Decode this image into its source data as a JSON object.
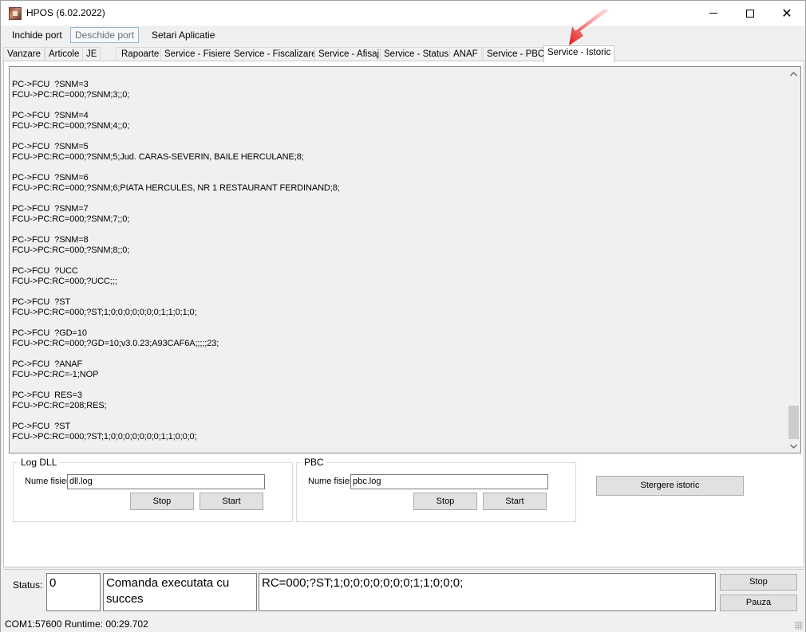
{
  "window": {
    "title": "HPOS (6.02.2022)"
  },
  "menu": {
    "items": [
      "Inchide port",
      "Deschide port",
      "Setari Aplicatie"
    ]
  },
  "tabs": [
    "Vanzare",
    "Articole",
    "JE",
    "Rapoarte",
    "Service - Fisiere",
    "Service - Fiscalizare",
    "Service - Afisaj",
    "Service - Status",
    "ANAF",
    "Service - PBC",
    "Service - Istoric"
  ],
  "active_tab": "Service - Istoric",
  "log": [
    [
      "PC->FCU  ?SNM=3",
      "FCU->PC:RC=000;?SNM;3;;0;"
    ],
    [
      "PC->FCU  ?SNM=4",
      "FCU->PC:RC=000;?SNM;4;;0;"
    ],
    [
      "PC->FCU  ?SNM=5",
      "FCU->PC:RC=000;?SNM;5;Jud. CARAS-SEVERIN, BAILE HERCULANE;8;"
    ],
    [
      "PC->FCU  ?SNM=6",
      "FCU->PC:RC=000;?SNM;6;PIATA HERCULES, NR 1 RESTAURANT FERDINAND;8;"
    ],
    [
      "PC->FCU  ?SNM=7",
      "FCU->PC:RC=000;?SNM;7;;0;"
    ],
    [
      "PC->FCU  ?SNM=8",
      "FCU->PC:RC=000;?SNM;8;;0;"
    ],
    [
      "PC->FCU  ?UCC",
      "FCU->PC:RC=000;?UCC;;;"
    ],
    [
      "PC->FCU  ?ST",
      "FCU->PC:RC=000;?ST;1;0;0;0;0;0;0;0;1;1;0;1;0;"
    ],
    [
      "PC->FCU  ?GD=10",
      "FCU->PC:RC=000;?GD=10;v3.0.23;A93CAF6A;;;;;23;"
    ],
    [
      "PC->FCU  ?ANAF",
      "FCU->PC:RC=-1;NOP"
    ],
    [
      "PC->FCU  RES=3",
      "FCU->PC:RC=208;RES;"
    ],
    [
      "PC->FCU  ?ST",
      "FCU->PC:RC=000;?ST;1;0;0;0;0;0;0;0;1;1;0;0;0;"
    ]
  ],
  "log_dll": {
    "title": "Log DLL",
    "file_label": "Nume fisier",
    "file_value": "dll.log",
    "stop": "Stop",
    "start": "Start"
  },
  "pbc": {
    "title": "PBC",
    "file_label": "Nume fisier",
    "file_value": "pbc.log",
    "stop": "Stop",
    "start": "Start"
  },
  "clear_history": "Stergere istoric",
  "status": {
    "label": "Status:",
    "code": "0",
    "message": "Comanda executata cu succes",
    "response": "RC=000;?ST;1;0;0;0;0;0;0;0;1;1;0;0;0;",
    "stop": "Stop",
    "pause": "Pauza"
  },
  "statusbar": {
    "port": "COM1:57600",
    "runtime": "Runtime: 00:29.702"
  },
  "colors": {
    "active_tab_bg": "#ffffff",
    "log_bg": "#f0f0f0",
    "annotation_arrow": "#e02020"
  }
}
